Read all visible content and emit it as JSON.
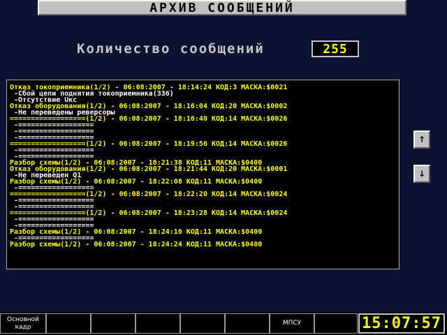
{
  "header": {
    "title": "АРХИВ СООБЩЕНИЙ"
  },
  "summary": {
    "count_label": "Количество сообщений",
    "count_value": "255"
  },
  "log": {
    "lines": [
      {
        "color": "#ffff00",
        "text": "Отказ токоприемника(1/2) - 06:08:2007 - 18:14:24 КОД:3 МАСКА:$0021"
      },
      {
        "color": "#ffffff",
        "text": " -Сбой цепи поднятия токоприемника(336)"
      },
      {
        "color": "#ffffff",
        "text": " -Отсутствие Uкс"
      },
      {
        "color": "#ffff00",
        "text": "Отказ оборудования(1/2) - 06:08:2007 - 18:16:04 КОД:20 МАСКА:$0002"
      },
      {
        "color": "#ffffff",
        "text": " -Не переведены реверсоры"
      },
      {
        "color": "#ffff00",
        "text": "==================(1/2) - 06:08:2007 - 18:16:40 КОД:14 МАСКА:$0026"
      },
      {
        "color": "#ffffff",
        "text": " -=================="
      },
      {
        "color": "#ffffff",
        "text": " -=================="
      },
      {
        "color": "#ffffff",
        "text": " -=================="
      },
      {
        "color": "#ffff00",
        "text": "==================(1/2) - 06:08:2007 - 18:19:56 КОД:14 МАСКА:$0026"
      },
      {
        "color": "#ffffff",
        "text": " -=================="
      },
      {
        "color": "#ffffff",
        "text": " -=================="
      },
      {
        "color": "#ffff00",
        "text": "Разбор схемы(1/2) - 06:08:2007 - 18:21:38 КОД:11 МАСКА:$0400"
      },
      {
        "color": "#ffff00",
        "text": "Отказ оборудования(1/2) - 06:08:2007 - 18:21:44 КОД:20 МАСКА:$0001"
      },
      {
        "color": "#ffffff",
        "text": " -Не переведен Q1"
      },
      {
        "color": "#ffff00",
        "text": "Разбор схемы(1/2) - 06:08:2007 - 18:22:08 КОД:11 МАСКА:$0400"
      },
      {
        "color": "#ffffff",
        "text": " -=================="
      },
      {
        "color": "#ffff00",
        "text": "==================(1/2) - 06:08:2007 - 18:22:20 КОД:14 МАСКА:$0024"
      },
      {
        "color": "#ffffff",
        "text": " -=================="
      },
      {
        "color": "#ffffff",
        "text": " -=================="
      },
      {
        "color": "#ffff00",
        "text": "==================(1/2) - 06:08:2007 - 18:23:28 КОД:14 МАСКА:$0024"
      },
      {
        "color": "#ffffff",
        "text": " -=================="
      },
      {
        "color": "#ffffff",
        "text": " -=================="
      },
      {
        "color": "#ffff00",
        "text": "Разбор схемы(1/2) - 06:08:2007 - 18:24:16 КОД:11 МАСКА:$0400"
      },
      {
        "color": "#ffffff",
        "text": " -=================="
      },
      {
        "color": "#ffff00",
        "text": "Разбор схемы(1/2) - 06:08:2007 - 18:24:24 КОД:11 МАСКА:$0400"
      }
    ]
  },
  "scroll": {
    "up_icon": "↑",
    "down_icon": "↓"
  },
  "footer": {
    "keys": [
      {
        "name": "fkey-osnovnoy-kadr",
        "label": "Основной\nкадр"
      },
      {
        "name": "fkey-2",
        "label": ""
      },
      {
        "name": "fkey-3",
        "label": ""
      },
      {
        "name": "fkey-4",
        "label": ""
      },
      {
        "name": "fkey-5",
        "label": ""
      },
      {
        "name": "fkey-6",
        "label": ""
      },
      {
        "name": "fkey-mpsu",
        "label": "МПСУ"
      },
      {
        "name": "fkey-8",
        "label": ""
      }
    ],
    "clock": "15:07:57"
  },
  "colors": {
    "background": "#0c1432",
    "accent": "#ffff00",
    "panel_border": "#a8a8a8"
  }
}
